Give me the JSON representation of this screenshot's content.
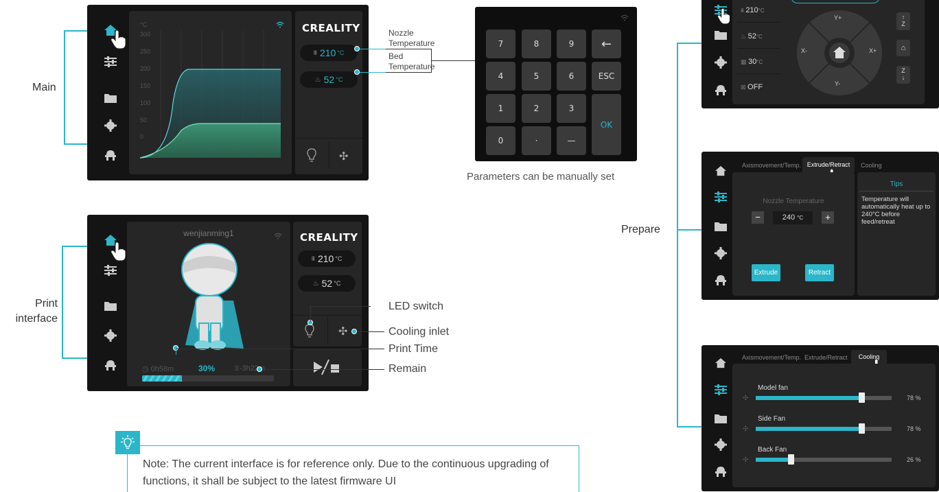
{
  "labels": {
    "main": "Main",
    "print_interface": "Print\ninterface",
    "prepare": "Prepare",
    "nozzle_temperature": "Nozzle\nTemperature",
    "bed_temperature": "Bed\nTemperature",
    "manual_set": "Parameters can be manually set",
    "led_switch": "LED switch",
    "cooling_inlet": "Cooling inlet",
    "print_time": "Print Time",
    "remain": "Remain"
  },
  "brand": "CREALITY",
  "main_screen": {
    "y_unit": "°C",
    "y_ticks": [
      "300",
      "250",
      "200",
      "150",
      "100",
      "50",
      "0"
    ],
    "nozzle_temp": "210",
    "bed_temp": "52",
    "unit": "°C"
  },
  "keypad": {
    "keys": [
      "7",
      "8",
      "9",
      "←",
      "4",
      "5",
      "6",
      "ESC",
      "1",
      "2",
      "3",
      "OK",
      "0",
      "·",
      "—"
    ]
  },
  "print_screen": {
    "model_name": "wenjianming1",
    "elapsed": "0h58m",
    "progress_label": "30%",
    "progress": 0.3,
    "remain": "-3h22m",
    "nozzle_temp": "210",
    "bed_temp": "52",
    "unit": "°C"
  },
  "prepare_top": {
    "temps": [
      {
        "icon": "nozzle-icon",
        "value": "210",
        "unit": "°C"
      },
      {
        "icon": "bed-icon",
        "value": "52",
        "unit": "°C"
      },
      {
        "icon": "chamber-icon",
        "value": "30",
        "unit": "°C"
      },
      {
        "icon": "fan-off-icon",
        "value": "OFF",
        "unit": ""
      }
    ],
    "dpad": {
      "up": "Y+",
      "down": "Y-",
      "left": "X-",
      "right": "X+"
    },
    "z_up": "Z",
    "z_down": "Z"
  },
  "prepare_mid": {
    "tabs": [
      "Axismovement/Temp.",
      "Extrude/Retract",
      "Cooling"
    ],
    "active_tab": "Extrude/Retract",
    "field_title": "Nozzle Temperature",
    "minus": "−",
    "plus": "+",
    "value": "240",
    "unit": "°C",
    "extrude": "Extrude",
    "retract": "Retract",
    "tips_title": "Tips",
    "tips_text": "Temperature will automatically heat up to 240°C before feed/retreat"
  },
  "prepare_bot": {
    "tabs": [
      "Axismovement/Temp.",
      "Extrude/Retract",
      "Cooling"
    ],
    "active_tab": "Cooling",
    "fans": [
      {
        "name": "Model fan",
        "level": 0.78,
        "pct": "78 %"
      },
      {
        "name": "Side Fan",
        "level": 0.78,
        "pct": "78 %"
      },
      {
        "name": "Back Fan",
        "level": 0.26,
        "pct": "26 %"
      }
    ]
  },
  "note": {
    "text": "Note: The current interface is for reference only. Due to the continuous upgrading of functions, it shall be subject to the latest firmware UI"
  },
  "colors": {
    "accent": "#2bb6c9",
    "screen_bg": "#141414",
    "panel_bg": "#262626"
  }
}
